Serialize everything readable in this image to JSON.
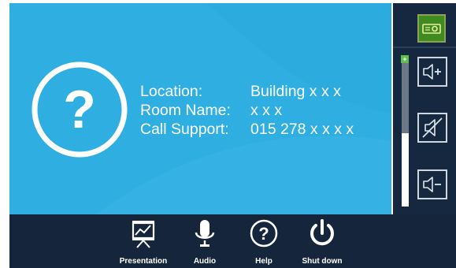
{
  "info": {
    "location_label": "Location:",
    "location_value": "Building x x x",
    "room_label": "Room Name:",
    "room_value": "x x x",
    "support_label": "Call Support:",
    "support_value": "015 278 x x x x"
  },
  "icons": {
    "main": "question-circle-icon",
    "projector": "projector-icon",
    "volume_up": "volume-up-icon",
    "mute": "mute-icon",
    "volume_down": "volume-down-icon",
    "presentation": "presentation-icon",
    "audio": "microphone-icon",
    "help": "help-icon",
    "shutdown": "power-icon"
  },
  "volume": {
    "level_percent": 50,
    "plus_marker": "+"
  },
  "nav": {
    "presentation": "Presentation",
    "audio": "Audio",
    "help": "Help",
    "shutdown": "Shut down"
  },
  "colors": {
    "screen": "#2faee2",
    "bar": "#14253c",
    "active": "#3f8b20"
  }
}
